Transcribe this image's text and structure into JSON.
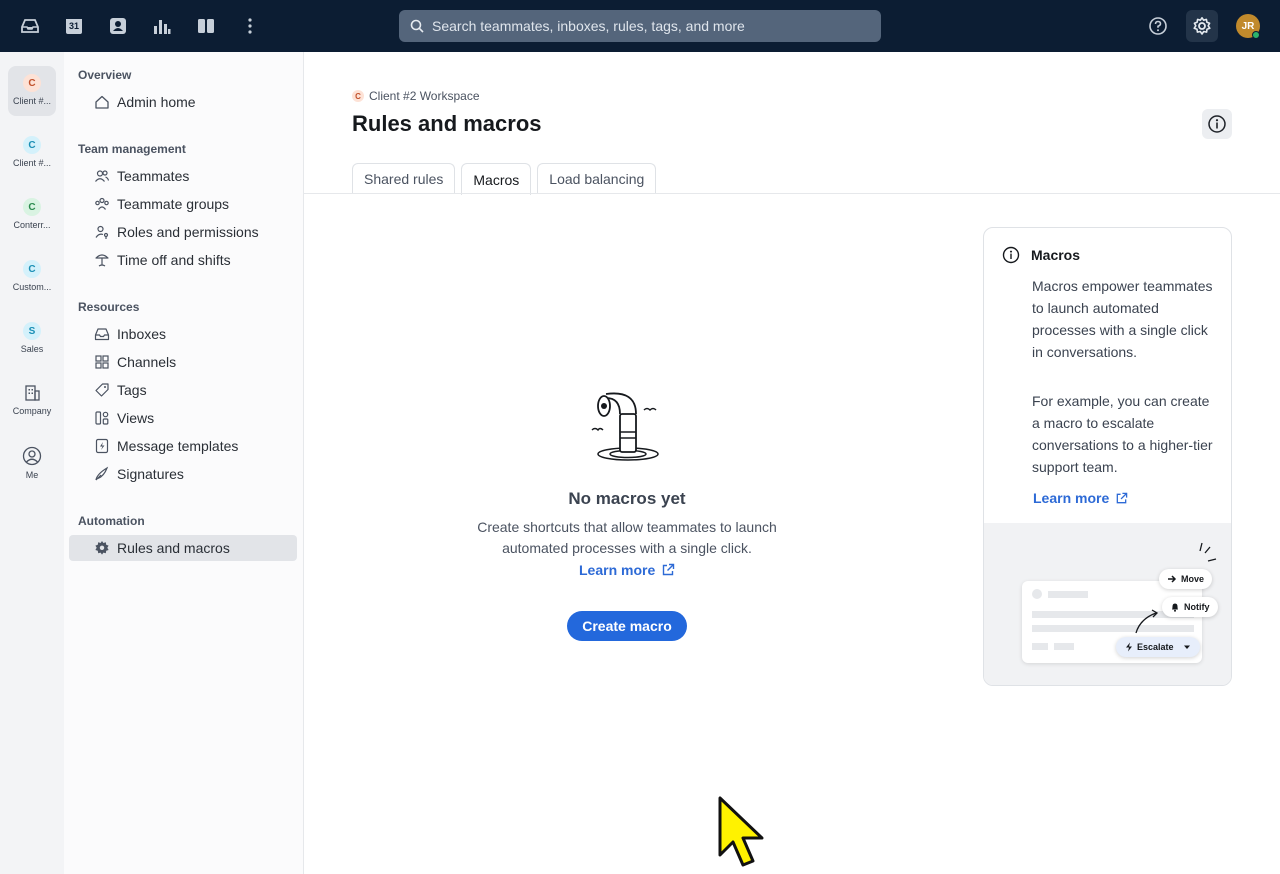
{
  "topbar": {
    "search_placeholder": "Search teammates, inboxes, rules, tags, and more",
    "calendar_day": "31",
    "user_initials": "JR"
  },
  "rail": {
    "items": [
      {
        "badge": "C",
        "label": "Client #...",
        "badge_bg": "#fde2d6",
        "badge_fg": "#c1512b",
        "active": true
      },
      {
        "badge": "C",
        "label": "Client #...",
        "badge_bg": "#d4f1fb",
        "badge_fg": "#1b8fb5",
        "active": false
      },
      {
        "badge": "C",
        "label": "Conterr...",
        "badge_bg": "#d9f3e2",
        "badge_fg": "#2b8a4e",
        "active": false
      },
      {
        "badge": "C",
        "label": "Custom...",
        "badge_bg": "#d4f1fb",
        "badge_fg": "#1b8fb5",
        "active": false
      },
      {
        "badge": "S",
        "label": "Sales",
        "badge_bg": "#d4f1fb",
        "badge_fg": "#1b8fb5",
        "active": false
      }
    ],
    "company_label": "Company",
    "me_label": "Me"
  },
  "sidebar": {
    "overview": {
      "title": "Overview",
      "items": [
        "Admin home"
      ]
    },
    "team": {
      "title": "Team management",
      "items": [
        "Teammates",
        "Teammate groups",
        "Roles and permissions",
        "Time off and shifts"
      ]
    },
    "resources": {
      "title": "Resources",
      "items": [
        "Inboxes",
        "Channels",
        "Tags",
        "Views",
        "Message templates",
        "Signatures"
      ]
    },
    "automation": {
      "title": "Automation",
      "items": [
        "Rules and macros"
      ]
    }
  },
  "main": {
    "breadcrumb_badge": "C",
    "breadcrumb": "Client #2 Workspace",
    "title": "Rules and macros",
    "tabs": [
      "Shared rules",
      "Macros",
      "Load balancing"
    ],
    "active_tab": "Macros",
    "empty": {
      "title": "No macros yet",
      "description": "Create shortcuts that allow teammates to launch automated processes with a single click.",
      "link": "Learn more",
      "button": "Create macro"
    },
    "help": {
      "title": "Macros",
      "p1": "Macros empower teammates to launch automated processes with a single click in conversations.",
      "p2": "For example, you can create a macro to escalate conversations to a higher-tier support team.",
      "link": "Learn more",
      "pill_move": "Move",
      "pill_notify": "Notify",
      "pill_escalate": "Escalate"
    }
  },
  "colors": {
    "topbar": "#0c1d33",
    "accent": "#2368dc",
    "link": "#2d6ad6"
  }
}
